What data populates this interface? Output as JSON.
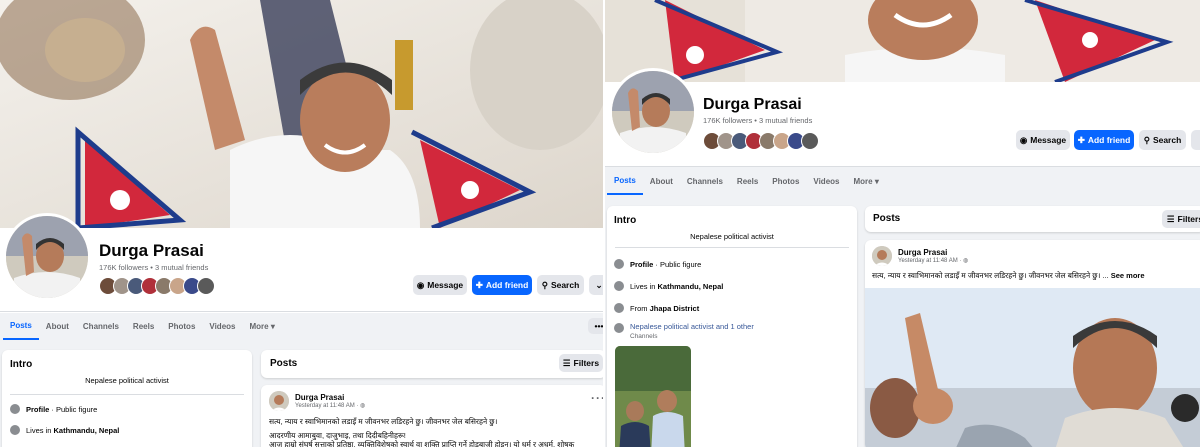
{
  "left": {
    "profile": {
      "name": "Durga Prasai",
      "stats": "176K followers • 3 mutual friends"
    },
    "buttons": {
      "message": "Message",
      "add_friend": "Add friend",
      "search": "Search"
    },
    "tabs": [
      "Posts",
      "About",
      "Channels",
      "Reels",
      "Photos",
      "Videos",
      "More ▾"
    ],
    "intro": {
      "title": "Intro",
      "bio": "Nepalese political activist",
      "profile_prefix": "Profile",
      "profile_suffix": " · Public figure",
      "lives_prefix": "Lives in ",
      "lives_place": "Kathmandu, Nepal"
    },
    "posts": {
      "title": "Posts",
      "filters": "Filters",
      "author": "Durga Prasai",
      "time": "Yesterday at 11:48 AM · ◍",
      "line1": "सत्य, न्याय र स्वाभिमानको लडाइँ म जीवनभर लडिरहने छु। जीवनभर जेल बसिरहने छु।",
      "line2": "आदरणीय आमाबुवा, दाजुभाइ, तथा दिदीबहिनीहरू!",
      "line3": "आज हाम्रो संघर्ष सत्ताको प्रतिष्ठा, व्यक्तिविशेषको स्वार्थ वा शक्ति प्राप्ति गर्ने होडबाजी होइन। यो धर्म र अधर्म, शोषक"
    }
  },
  "right": {
    "profile": {
      "name": "Durga Prasai",
      "stats": "176K followers • 3 mutual friends"
    },
    "buttons": {
      "message": "Message",
      "add_friend": "Add friend",
      "search": "Search"
    },
    "tabs": [
      "Posts",
      "About",
      "Channels",
      "Reels",
      "Photos",
      "Videos",
      "More ▾"
    ],
    "intro": {
      "title": "Intro",
      "bio": "Nepalese political activist",
      "profile_prefix": "Profile",
      "profile_suffix": " · Public figure",
      "lives_prefix": "Lives in ",
      "lives_place": "Kathmandu, Nepal",
      "from_prefix": "From ",
      "from_place": "Jhapa District",
      "channel_link": "Nepalese political activist and 1 other",
      "channel_sub": "Channels"
    },
    "posts": {
      "title": "Posts",
      "filters": "Filters",
      "author": "Durga Prasai",
      "time": "Yesterday at 11:48 AM · ◍",
      "line1": "सत्य, न्याय र स्वाभिमानको लडाइँ म जीवनभर लडिरहने छु। जीवनभर जेल बसिरहने छु। ...",
      "see_more": "See more"
    }
  },
  "colors": {
    "accent": "#0866ff",
    "page_bg": "#f0f2f5",
    "flag_red": "#d2283c",
    "flag_blue": "#1e3c8c"
  }
}
